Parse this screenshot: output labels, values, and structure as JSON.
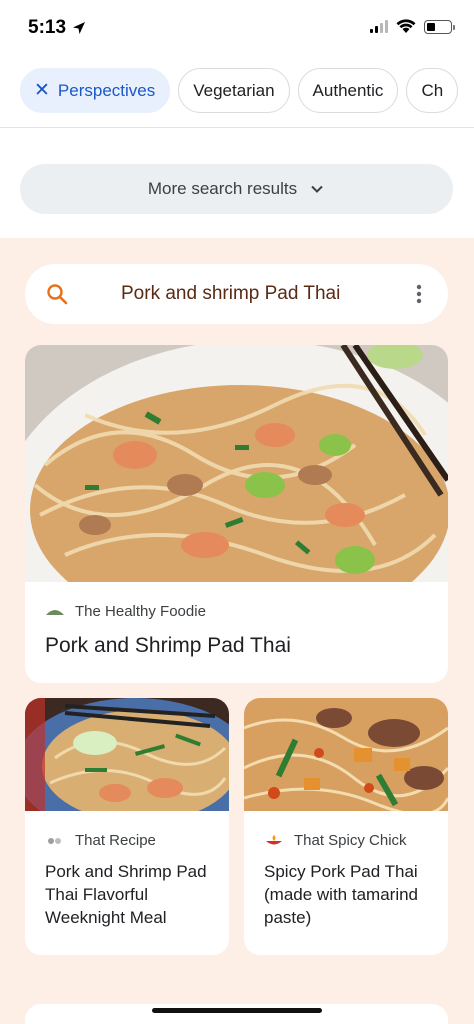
{
  "status_bar": {
    "time": "5:13"
  },
  "chips": [
    {
      "label": "Perspectives",
      "active": true
    },
    {
      "label": "Vegetarian",
      "active": false
    },
    {
      "label": "Authentic",
      "active": false
    },
    {
      "label": "Ch",
      "active": false
    }
  ],
  "more_results": {
    "label": "More search results"
  },
  "perspectives": {
    "query": "Pork and shrimp Pad Thai",
    "cards": [
      {
        "source": "The Healthy Foodie",
        "title": "Pork and Shrimp Pad Thai"
      },
      {
        "source": "That Recipe",
        "title": "Pork and Shrimp Pad Thai Flavorful Weeknight Meal"
      },
      {
        "source": "That Spicy Chick",
        "title": "Spicy Pork Pad Thai (made with tamarind paste)"
      }
    ]
  },
  "colors": {
    "panel_bg": "#fdeee6",
    "active_chip_bg": "#e8f0fe",
    "active_chip_text": "#1a57c6",
    "search_icon": "#e8711a"
  },
  "icons": [
    "location-arrow-icon",
    "signal-icon",
    "wifi-icon",
    "battery-icon",
    "close-icon",
    "chevron-down-icon",
    "search-icon",
    "more-vert-icon",
    "source-favicon-icon"
  ]
}
